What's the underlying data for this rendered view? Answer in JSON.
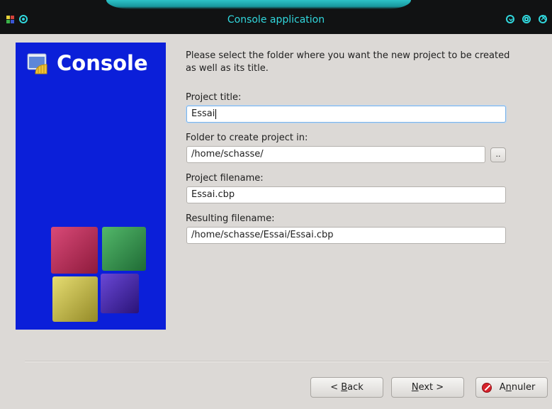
{
  "window": {
    "title": "Console application"
  },
  "banner": {
    "title": "Console",
    "background": "#0b1fd9"
  },
  "form": {
    "intro": "Please select the folder where you want the new project to be created as well as its title.",
    "project_title_label": "Project title:",
    "project_title_value": "Essai",
    "folder_label": "Folder to create project in:",
    "folder_value": "/home/schasse/",
    "browse_label": "..",
    "filename_label": "Project filename:",
    "filename_value": "Essai.cbp",
    "resulting_label": "Resulting filename:",
    "resulting_value": "/home/schasse/Essai/Essai.cbp"
  },
  "buttons": {
    "back_prefix": "< ",
    "back_mnemonic": "B",
    "back_rest": "ack",
    "next_mnemonic": "N",
    "next_rest": "ext >",
    "cancel_prefix": "A",
    "cancel_mnemonic": "n",
    "cancel_rest": "nuler"
  },
  "colors": {
    "accent": "#31d7dd",
    "banner_blue": "#0b1fd9",
    "focus": "#7fb3e6"
  }
}
